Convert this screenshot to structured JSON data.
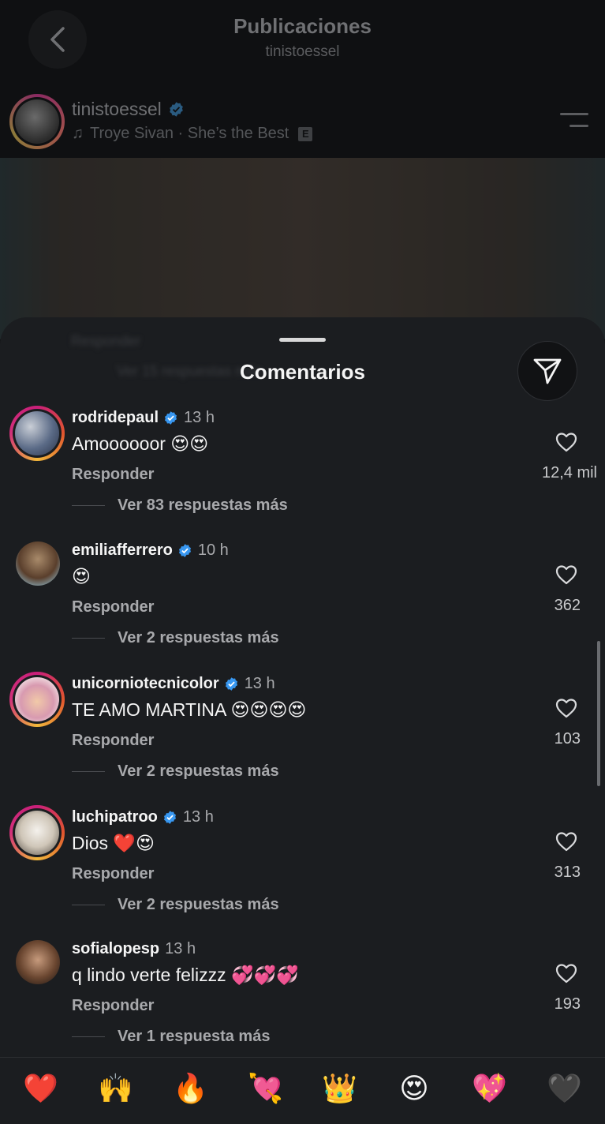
{
  "header": {
    "title": "Publicaciones",
    "subtitle": "tinistoessel"
  },
  "post": {
    "username": "tinistoessel",
    "song": "Troye Sivan · She’s the Best",
    "explicit_badge": "E"
  },
  "sheet": {
    "title": "Comentarios",
    "background_ghost_reply": "Responder",
    "background_ghost_more": "Ver 15 respuestas más"
  },
  "comments": [
    {
      "username": "rodridepaul",
      "verified": true,
      "time": "13 h",
      "text": "Amoooooor 😍😍",
      "reply_label": "Responder",
      "likes": "12,4 mil",
      "more_replies": "Ver 83 respuestas más"
    },
    {
      "username": "emiliafferrero",
      "verified": true,
      "time": "10 h",
      "text": "😍",
      "reply_label": "Responder",
      "likes": "362",
      "more_replies": "Ver 2 respuestas más"
    },
    {
      "username": "unicorniotecnicolor",
      "verified": true,
      "time": "13 h",
      "text": "TE AMO MARTINA 😍😍😍😍",
      "reply_label": "Responder",
      "likes": "103",
      "more_replies": "Ver 2 respuestas más"
    },
    {
      "username": "luchipatroo",
      "verified": true,
      "time": "13 h",
      "text": "Dios ❤️😍",
      "reply_label": "Responder",
      "likes": "313",
      "more_replies": "Ver 2 respuestas más"
    },
    {
      "username": "sofialopesp",
      "verified": false,
      "time": "13 h",
      "text": "q lindo verte felizzz 💞💞💞",
      "reply_label": "Responder",
      "likes": "193",
      "more_replies": "Ver 1 respuesta más"
    }
  ],
  "emoji_bar": [
    "❤️",
    "🙌",
    "🔥",
    "💘",
    "👑",
    "😍",
    "💖",
    "🖤"
  ],
  "colors": {
    "sheet_bg": "#1b1d20",
    "verified": "#3897f0",
    "story_ring": "#d1307a"
  }
}
